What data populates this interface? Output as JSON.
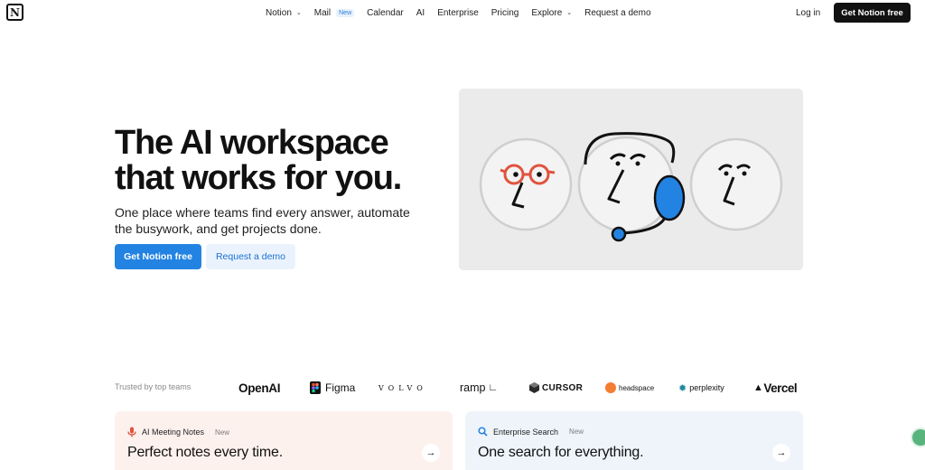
{
  "nav": {
    "logo_letter": "N",
    "items": [
      {
        "label": "Notion",
        "dropdown": true
      },
      {
        "label": "Mail",
        "badge": "New"
      },
      {
        "label": "Calendar"
      },
      {
        "label": "AI"
      },
      {
        "label": "Enterprise"
      },
      {
        "label": "Pricing"
      },
      {
        "label": "Explore",
        "dropdown": true
      },
      {
        "label": "Request a demo"
      }
    ],
    "login": "Log in",
    "cta": "Get Notion free"
  },
  "hero": {
    "title_line1": "The AI workspace",
    "title_line2": "that works for you.",
    "subtitle": "One place where teams find every answer, automate the busywork, and get projects done.",
    "primary_button": "Get Notion free",
    "secondary_button": "Request a demo"
  },
  "trusted": {
    "label": "Trusted by top teams",
    "logos": [
      "OpenAI",
      "Figma",
      "VOLVO",
      "ramp",
      "CURSOR",
      "headspace",
      "perplexity",
      "Vercel"
    ]
  },
  "cards": [
    {
      "label": "AI Meeting Notes",
      "badge": "New",
      "title": "Perfect notes every time.",
      "icon": "microphone-icon",
      "icon_color": "#e0533d"
    },
    {
      "label": "Enterprise Search",
      "badge": "New",
      "title": "One search for everything.",
      "icon": "search-icon",
      "icon_color": "#2383e2"
    }
  ],
  "colors": {
    "accent": "#2383e2",
    "dark": "#111111"
  }
}
